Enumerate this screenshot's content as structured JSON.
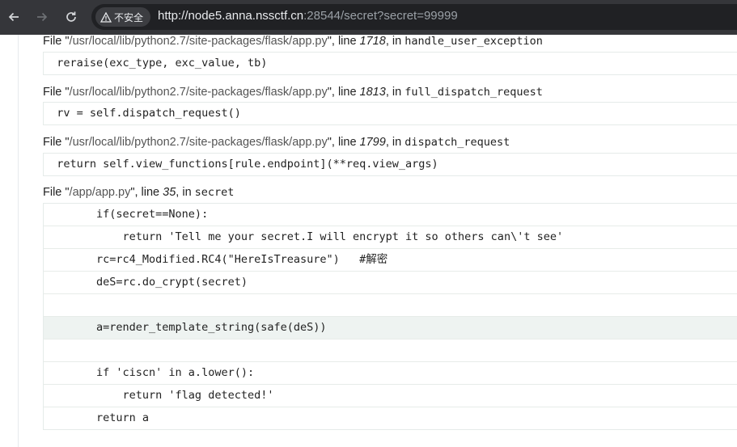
{
  "browser": {
    "security_label": "不安全",
    "url_host": "http://node5.anna.nssctf.cn",
    "url_rest": ":28544/secret?secret=99999"
  },
  "frames": [
    {
      "prefix": "File \"",
      "path": "/usr/local/lib/python2.7/site-packages/flask/app.py",
      "mid": "\", line ",
      "line": "1718",
      "in": ", in ",
      "function": "handle_user_exception",
      "code": [
        "  reraise(exc_type, exc_value, tb)"
      ]
    },
    {
      "prefix": "File \"",
      "path": "/usr/local/lib/python2.7/site-packages/flask/app.py",
      "mid": "\", line ",
      "line": "1813",
      "in": ", in ",
      "function": "full_dispatch_request",
      "code": [
        "  rv = self.dispatch_request()"
      ]
    },
    {
      "prefix": "File \"",
      "path": "/usr/local/lib/python2.7/site-packages/flask/app.py",
      "mid": "\", line ",
      "line": "1799",
      "in": ", in ",
      "function": "dispatch_request",
      "code": [
        "  return self.view_functions[rule.endpoint](**req.view_args)"
      ]
    },
    {
      "prefix": "File \"",
      "path": "/app/app.py",
      "mid": "\", line ",
      "line": "35",
      "in": ", in ",
      "function": "secret",
      "code": [
        "        if(secret==None):",
        "            return 'Tell me your secret.I will encrypt it so others can\\'t see'",
        "        rc=rc4_Modified.RC4(\"HereIsTreasure\")   #解密",
        "        deS=rc.do_crypt(secret)",
        "",
        "        a=render_template_string(safe(deS))",
        "",
        "        if 'ciscn' in a.lower():",
        "            return 'flag detected!'",
        "        return a"
      ],
      "current_index": 5
    }
  ]
}
